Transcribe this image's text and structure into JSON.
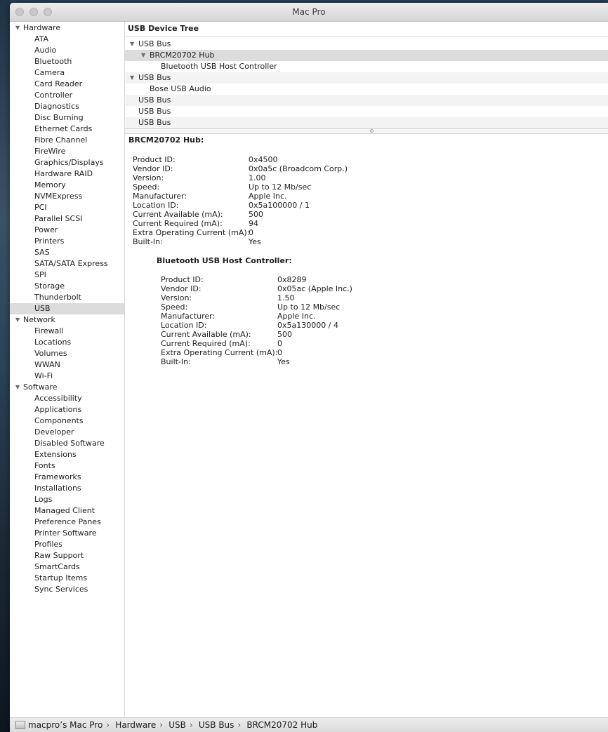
{
  "window": {
    "title": "Mac Pro"
  },
  "sidebar": {
    "groups": [
      {
        "label": "Hardware",
        "items": [
          "ATA",
          "Audio",
          "Bluetooth",
          "Camera",
          "Card Reader",
          "Controller",
          "Diagnostics",
          "Disc Burning",
          "Ethernet Cards",
          "Fibre Channel",
          "FireWire",
          "Graphics/Displays",
          "Hardware RAID",
          "Memory",
          "NVMExpress",
          "PCI",
          "Parallel SCSI",
          "Power",
          "Printers",
          "SAS",
          "SATA/SATA Express",
          "SPI",
          "Storage",
          "Thunderbolt",
          "USB"
        ]
      },
      {
        "label": "Network",
        "items": [
          "Firewall",
          "Locations",
          "Volumes",
          "WWAN",
          "Wi-Fi"
        ]
      },
      {
        "label": "Software",
        "items": [
          "Accessibility",
          "Applications",
          "Components",
          "Developer",
          "Disabled Software",
          "Extensions",
          "Fonts",
          "Frameworks",
          "Installations",
          "Logs",
          "Managed Client",
          "Preference Panes",
          "Printer Software",
          "Profiles",
          "Raw Support",
          "SmartCards",
          "Startup Items",
          "Sync Services"
        ]
      }
    ],
    "selected": "USB"
  },
  "tree": {
    "header": "USB Device Tree",
    "rows": [
      {
        "label": "USB Bus",
        "level": 0,
        "expanded": true
      },
      {
        "label": "BRCM20702 Hub",
        "level": 1,
        "expanded": true,
        "selected": true
      },
      {
        "label": "Bluetooth USB Host Controller",
        "level": 2
      },
      {
        "label": "USB Bus",
        "level": 0,
        "expanded": true
      },
      {
        "label": "Bose USB Audio",
        "level": 1
      },
      {
        "label": "USB Bus",
        "level": 0
      },
      {
        "label": "USB Bus",
        "level": 0
      },
      {
        "label": "USB Bus",
        "level": 0
      }
    ]
  },
  "detail": {
    "title": "BRCM20702 Hub:",
    "fields": [
      {
        "key": "Product ID:",
        "value": "0x4500"
      },
      {
        "key": "Vendor ID:",
        "value": "0x0a5c  (Broadcom Corp.)"
      },
      {
        "key": "Version:",
        "value": "1.00"
      },
      {
        "key": "Speed:",
        "value": "Up to 12 Mb/sec"
      },
      {
        "key": "Manufacturer:",
        "value": "Apple Inc."
      },
      {
        "key": "Location ID:",
        "value": "0x5a100000 / 1"
      },
      {
        "key": "Current Available (mA):",
        "value": "500"
      },
      {
        "key": "Current Required (mA):",
        "value": "94"
      },
      {
        "key": "Extra Operating Current (mA):",
        "value": "0"
      },
      {
        "key": "Built-In:",
        "value": "Yes"
      }
    ],
    "child": {
      "title": "Bluetooth USB Host Controller:",
      "fields": [
        {
          "key": "Product ID:",
          "value": "0x8289"
        },
        {
          "key": "Vendor ID:",
          "value": "0x05ac (Apple Inc.)"
        },
        {
          "key": "Version:",
          "value": "1.50"
        },
        {
          "key": "Speed:",
          "value": "Up to 12 Mb/sec"
        },
        {
          "key": "Manufacturer:",
          "value": "Apple Inc."
        },
        {
          "key": "Location ID:",
          "value": "0x5a130000 / 4"
        },
        {
          "key": "Current Available (mA):",
          "value": "500"
        },
        {
          "key": "Current Required (mA):",
          "value": "0"
        },
        {
          "key": "Extra Operating Current (mA):",
          "value": "0"
        },
        {
          "key": "Built-In:",
          "value": "Yes"
        }
      ]
    }
  },
  "statusbar": {
    "path": [
      "macpro’s Mac Pro",
      "Hardware",
      "USB",
      "USB Bus",
      "BRCM20702 Hub"
    ],
    "separator": "›"
  }
}
